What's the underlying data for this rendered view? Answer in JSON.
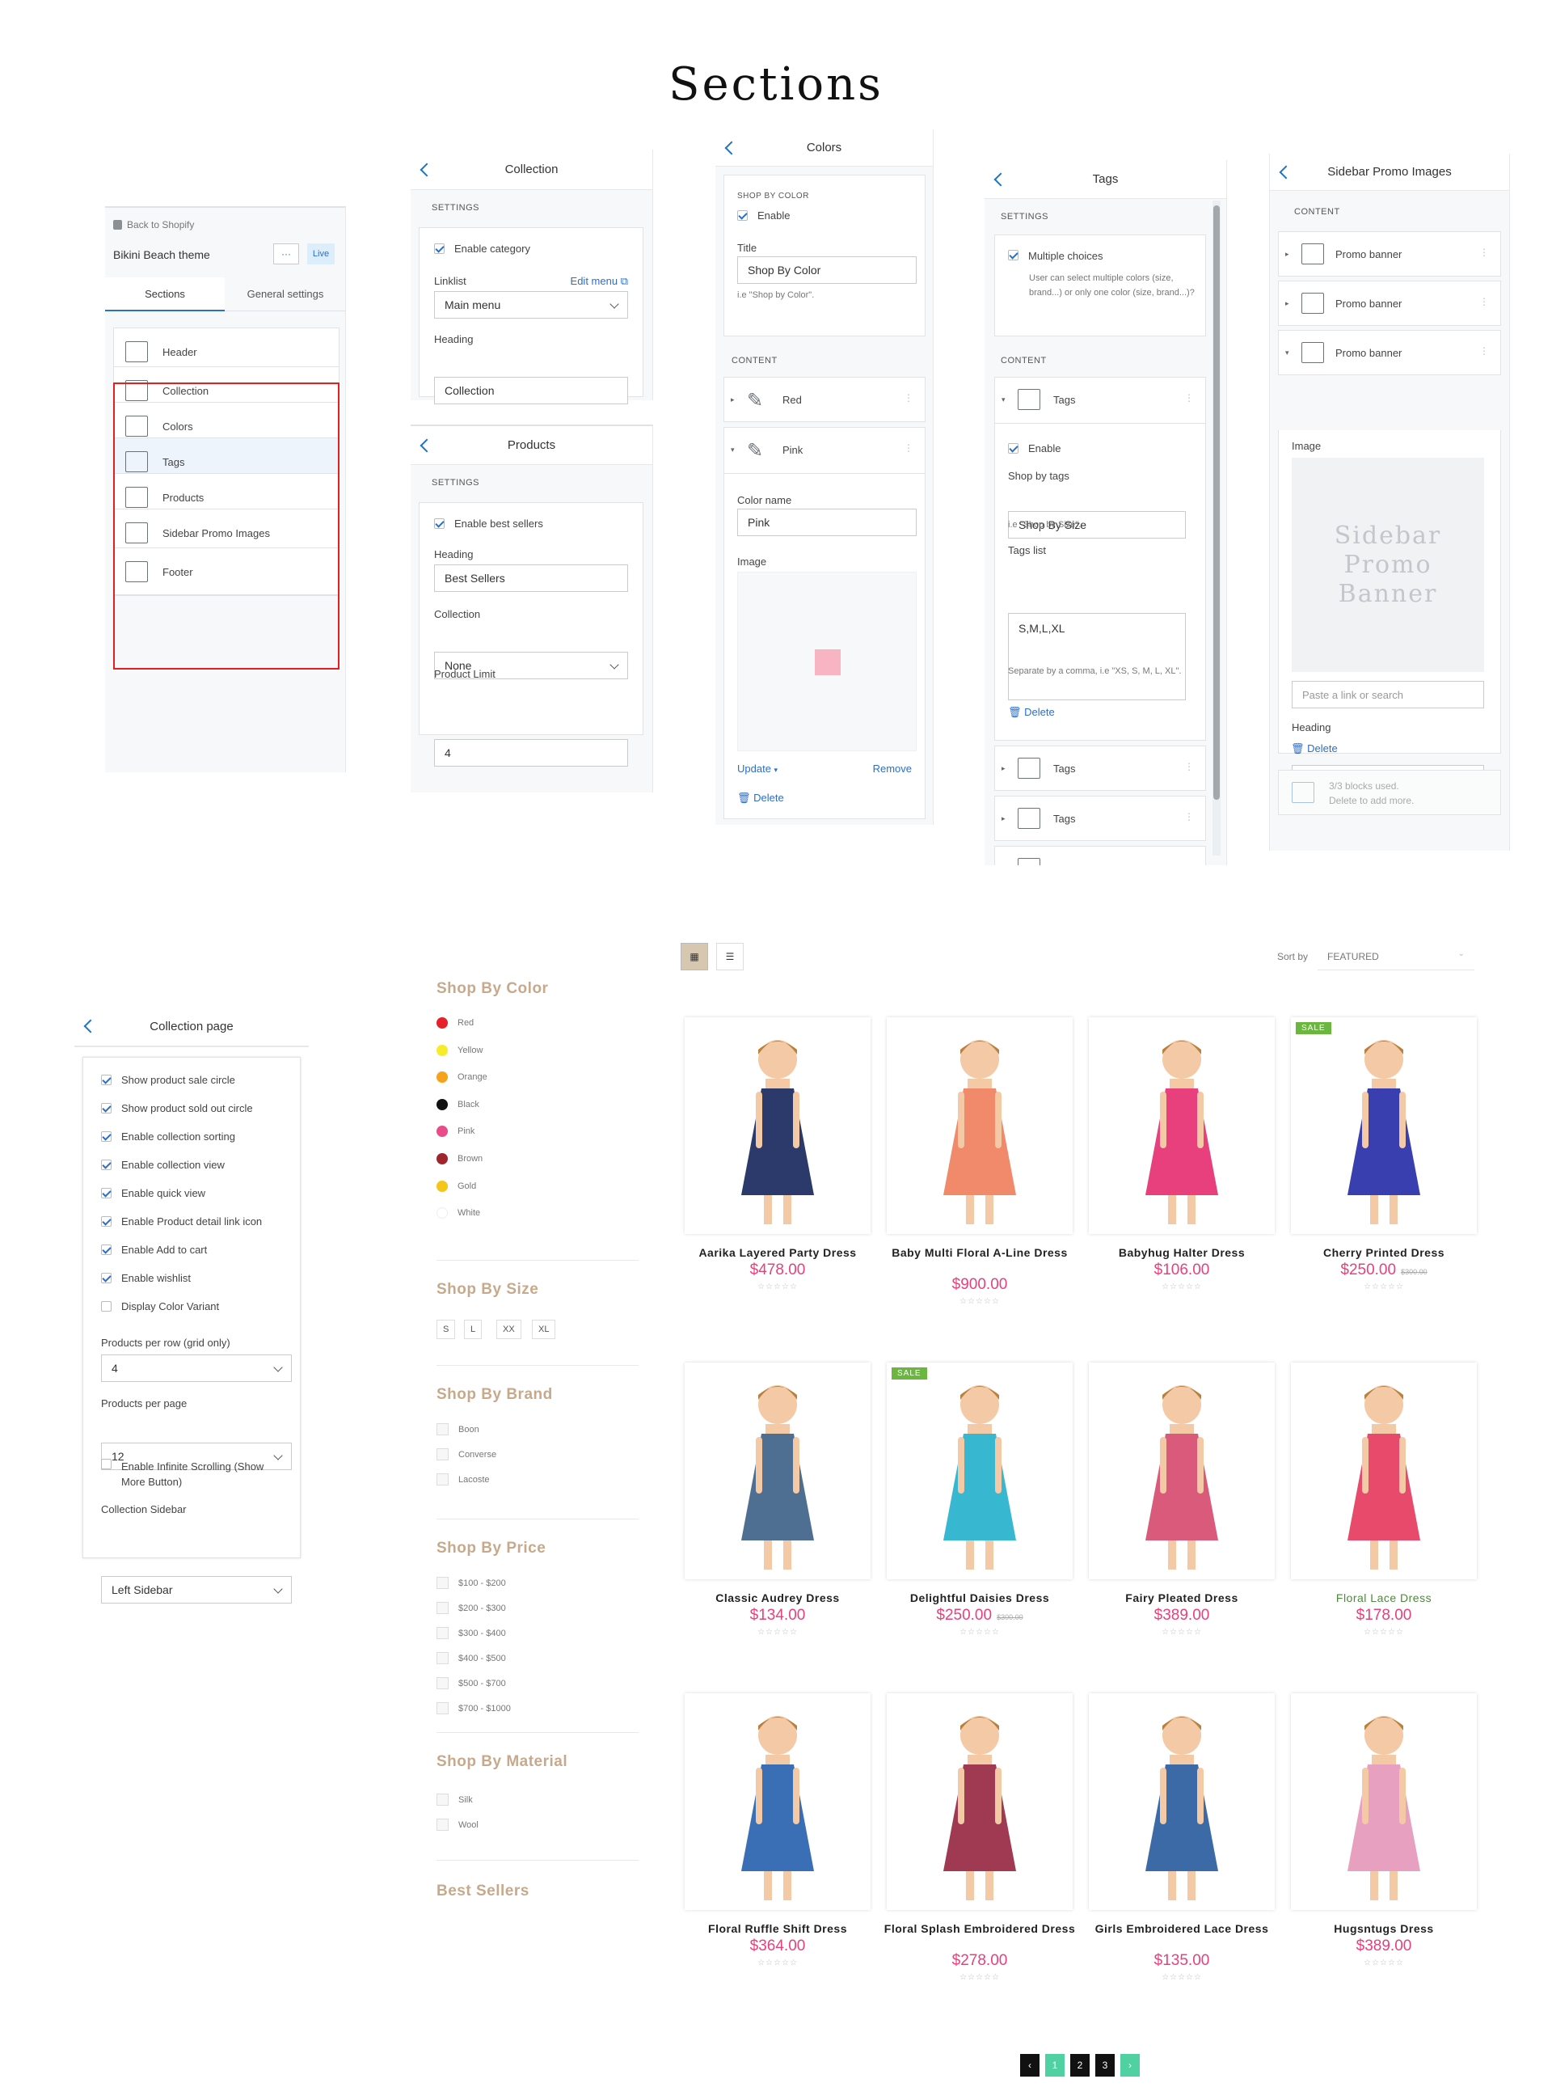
{
  "page": {
    "title": "Sections"
  },
  "theme_panel": {
    "back_label": "Back to Shopify",
    "theme_name": "Bikini Beach theme",
    "more_label": "···",
    "live_badge": "Live",
    "tabs": [
      "Sections",
      "General settings"
    ],
    "sections": [
      "Header",
      "Collection",
      "Colors",
      "Tags",
      "Products",
      "Sidebar Promo Images",
      "Footer"
    ]
  },
  "collection_panel": {
    "title": "Collection",
    "settings_label": "SETTINGS",
    "enable_label": "Enable category",
    "linklist_label": "Linklist",
    "edit_menu": "Edit menu",
    "linklist_value": "Main menu",
    "heading_label": "Heading",
    "heading_value": "Collection"
  },
  "products_panel": {
    "title": "Products",
    "settings_label": "SETTINGS",
    "enable_label": "Enable best sellers",
    "heading_label": "Heading",
    "heading_value": "Best Sellers",
    "collection_label": "Collection",
    "collection_value": "None",
    "limit_label": "Product Limit",
    "limit_value": "4"
  },
  "colors_panel": {
    "title": "Colors",
    "section_label": "SHOP BY COLOR",
    "enable_label": "Enable",
    "title_label": "Title",
    "title_value": "Shop By Color",
    "title_hint": "i.e \"Shop by Color\".",
    "content_label": "CONTENT",
    "blocks": [
      "Red",
      "Pink"
    ],
    "color_name_label": "Color name",
    "color_name_value": "Pink",
    "image_label": "Image",
    "swatch_color": "#f9b4c4",
    "update_label": "Update",
    "remove_label": "Remove",
    "delete_label": "Delete"
  },
  "tags_panel": {
    "title": "Tags",
    "settings_label": "SETTINGS",
    "multiple_label": "Multiple choices",
    "multiple_hint": "User can select multiple colors (size, brand...) or only one color (size, brand...)?",
    "content_label": "CONTENT",
    "block_label": "Tags",
    "enable_label": "Enable",
    "shop_by_label": "Shop by tags",
    "shop_by_value": "Shop By Size",
    "shop_by_hint": "i.e \"Shop by Size\".",
    "list_label": "Tags list",
    "list_value": "S,M,L,XL",
    "list_hint": "Separate by a comma, i.e \"XS, S, M, L, XL\".",
    "delete_label": "Delete",
    "extra_blocks": [
      "Tags",
      "Tags"
    ]
  },
  "promo_panel": {
    "title": "Sidebar Promo Images",
    "content_label": "CONTENT",
    "blocks": [
      "Promo banner",
      "Promo banner",
      "Promo banner"
    ],
    "image_label": "Image",
    "placeholder_text": "Sidebar Promo Banner",
    "link_placeholder": "Paste a link or search",
    "heading_label": "Heading",
    "delete_label": "Delete",
    "used_text": "3/3 blocks used.",
    "used_hint": "Delete to add more."
  },
  "collection_page_panel": {
    "title": "Collection page",
    "options": [
      {
        "label": "Show product sale circle",
        "checked": true
      },
      {
        "label": "Show product sold out circle",
        "checked": true
      },
      {
        "label": "Enable collection sorting",
        "checked": true
      },
      {
        "label": "Enable collection view",
        "checked": true
      },
      {
        "label": "Enable quick view",
        "checked": true
      },
      {
        "label": "Enable Product detail link icon",
        "checked": true
      },
      {
        "label": "Enable Add to cart",
        "checked": true
      },
      {
        "label": "Enable wishlist",
        "checked": true
      },
      {
        "label": "Display Color Variant",
        "checked": false
      }
    ],
    "per_row_label": "Products per row (grid only)",
    "per_row_value": "4",
    "per_page_label": "Products per page",
    "per_page_value": "12",
    "infinite_label": "Enable Infinite Scrolling (Show More Button)",
    "sidebar_label": "Collection Sidebar",
    "sidebar_value": "Left Sidebar"
  },
  "filters": {
    "color_heading": "Shop By Color",
    "colors": [
      {
        "name": "Red",
        "hex": "#e8202a"
      },
      {
        "name": "Yellow",
        "hex": "#f6ec2c"
      },
      {
        "name": "Orange",
        "hex": "#f7a21b"
      },
      {
        "name": "Black",
        "hex": "#111111"
      },
      {
        "name": "Pink",
        "hex": "#ea4c89"
      },
      {
        "name": "Brown",
        "hex": "#a0262e"
      },
      {
        "name": "Gold",
        "hex": "#f5c518"
      },
      {
        "name": "White",
        "hex": "#ffffff"
      }
    ],
    "size_heading": "Shop By Size",
    "sizes": [
      "S",
      "L",
      "XX",
      "XL"
    ],
    "brand_heading": "Shop By Brand",
    "brands": [
      "Boon",
      "Converse",
      "Lacoste"
    ],
    "price_heading": "Shop By Price",
    "prices": [
      "$100 - $200",
      "$200 - $300",
      "$300 - $400",
      "$400 - $500",
      "$500 - $700",
      "$700 - $1000"
    ],
    "material_heading": "Shop By Material",
    "materials": [
      "Silk",
      "Wool"
    ],
    "best_heading": "Best Sellers"
  },
  "toolbar": {
    "sort_label": "Sort by",
    "sort_value": "FEATURED"
  },
  "products": [
    {
      "name": "Aarika Layered Party Dress",
      "price": "$478.00",
      "old": "",
      "sale": false,
      "color": "#2b3a6b"
    },
    {
      "name": "Baby Multi Floral A-Line Dress",
      "price": "$900.00",
      "old": "",
      "sale": false,
      "color": "#f08a6a"
    },
    {
      "name": "Babyhug Halter Dress",
      "price": "$106.00",
      "old": "",
      "sale": false,
      "color": "#e8407c"
    },
    {
      "name": "Cherry Printed Dress",
      "price": "$250.00",
      "old": "$300.00",
      "sale": true,
      "color": "#3a3fb0"
    },
    {
      "name": "Classic Audrey Dress",
      "price": "$134.00",
      "old": "",
      "sale": false,
      "color": "#4e6f92"
    },
    {
      "name": "Delightful Daisies Dress",
      "price": "$250.00",
      "old": "$300.00",
      "sale": true,
      "color": "#38b8d0"
    },
    {
      "name": "Fairy Pleated Dress",
      "price": "$389.00",
      "old": "",
      "sale": false,
      "color": "#d95a7a"
    },
    {
      "name": "Floral Lace Dress",
      "price": "$178.00",
      "old": "",
      "sale": false,
      "color": "#e84a6b"
    },
    {
      "name": "Floral Ruffle Shift Dress",
      "price": "$364.00",
      "old": "",
      "sale": false,
      "color": "#3a6fb5"
    },
    {
      "name": "Floral Splash Embroidered Dress",
      "price": "$278.00",
      "old": "",
      "sale": false,
      "color": "#a03a52"
    },
    {
      "name": "Girls Embroidered Lace Dress",
      "price": "$135.00",
      "old": "",
      "sale": false,
      "color": "#3c6aa6"
    },
    {
      "name": "Hugsntugs Dress",
      "price": "$389.00",
      "old": "",
      "sale": false,
      "color": "#e7a0bf"
    }
  ],
  "pagination": {
    "prev": "‹",
    "pages": [
      "1",
      "2",
      "3"
    ],
    "next": "›"
  }
}
